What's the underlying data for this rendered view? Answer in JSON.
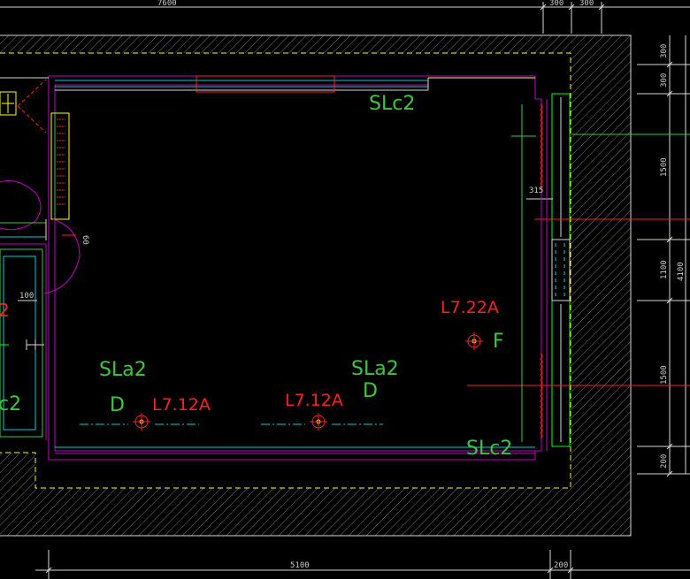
{
  "drawing": {
    "labels": {
      "slc2_top": "SLc2",
      "slc2_bottom": "SLc2",
      "sla2_left": "SLa2",
      "sla2_mid": "SLa2",
      "d_left": "D",
      "d_mid": "D",
      "f_label": "F",
      "l712_left": "L7.12A",
      "l712_mid": "L7.12A",
      "l722": "L7.22A",
      "partial_left_2": "2",
      "partial_left_c2": "c2"
    },
    "dimensions": {
      "top_overall": "7600",
      "top_a": "300",
      "top_b": "300",
      "right_300a": "300",
      "right_300b": "300",
      "right_1500a": "1500",
      "right_1100": "1100",
      "right_1500b": "1500",
      "right_200": "200",
      "right_total": "4100",
      "bottom_5100": "5100",
      "bottom_200": "200",
      "inner_315": "315",
      "inner_100": "100",
      "inner_60": "60"
    },
    "colors": {
      "background": "#000000",
      "green": "#3cc83c",
      "bright_green": "#00ff00",
      "red": "#ff2020",
      "magenta": "#c000c0",
      "cyan": "#00d0d0",
      "yellow": "#ffff00",
      "white": "#d8d8d8",
      "hatch": "#7a7a7a"
    }
  }
}
